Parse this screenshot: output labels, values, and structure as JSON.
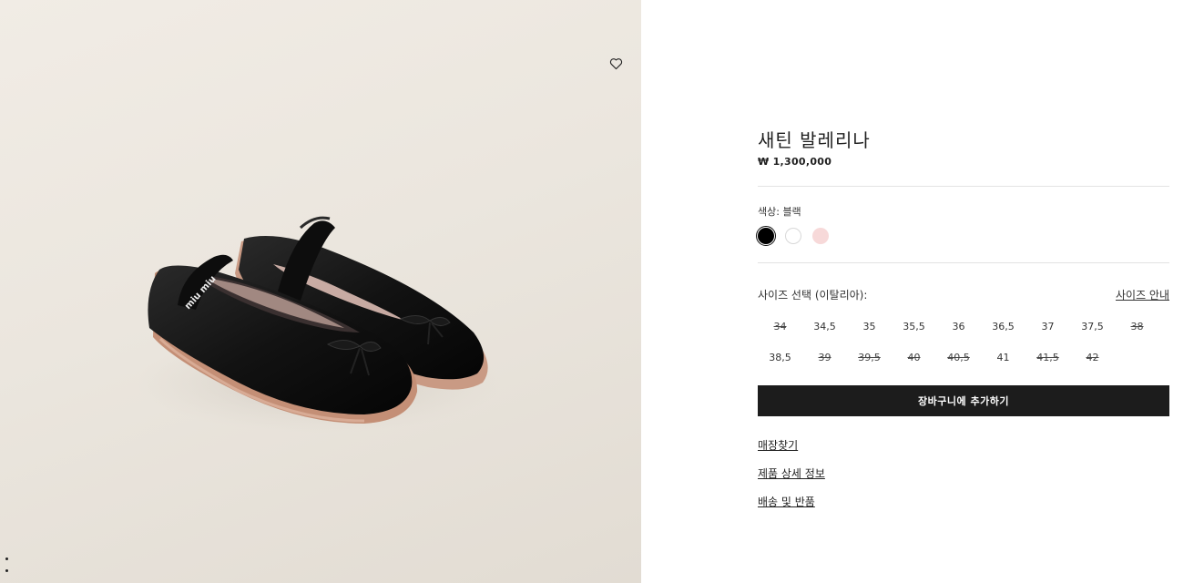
{
  "product": {
    "title": "새틴 발레리나",
    "price": "₩ 1,300,000"
  },
  "color": {
    "label": "색상:  블랙",
    "swatches": [
      {
        "name": "black",
        "hex": "#000000",
        "selected": true
      },
      {
        "name": "white",
        "hex": "#ffffff",
        "selected": false
      },
      {
        "name": "pink",
        "hex": "#f7d9d9",
        "selected": false
      }
    ]
  },
  "size": {
    "label": "사이즈 선택 (이탈리아):",
    "guide_label": "사이즈 안내",
    "options": [
      {
        "label": "34",
        "available": false
      },
      {
        "label": "34,5",
        "available": true
      },
      {
        "label": "35",
        "available": true
      },
      {
        "label": "35,5",
        "available": true
      },
      {
        "label": "36",
        "available": true
      },
      {
        "label": "36,5",
        "available": true
      },
      {
        "label": "37",
        "available": true
      },
      {
        "label": "37,5",
        "available": true
      },
      {
        "label": "38",
        "available": false
      },
      {
        "label": "38,5",
        "available": true
      },
      {
        "label": "39",
        "available": false
      },
      {
        "label": "39,5",
        "available": false
      },
      {
        "label": "40",
        "available": false
      },
      {
        "label": "40,5",
        "available": false
      },
      {
        "label": "41",
        "available": true
      },
      {
        "label": "41,5",
        "available": false
      },
      {
        "label": "42",
        "available": false
      }
    ]
  },
  "cart_button": "장바구니에 추가하기",
  "links": {
    "store": "매장찾기",
    "details": "제품 상세 정보",
    "shipping": "배송 및 반품"
  },
  "image": {
    "logo_text": "miu miu",
    "icons": [
      "heart-icon"
    ]
  }
}
